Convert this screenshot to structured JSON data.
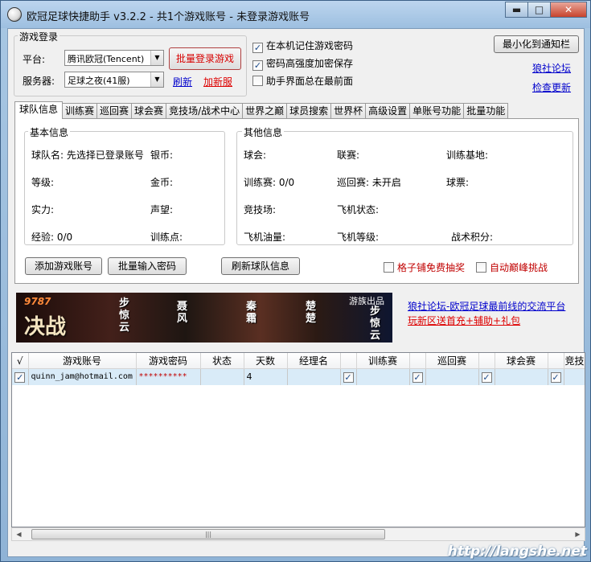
{
  "window": {
    "title": "欧冠足球快捷助手 v3.2.2  - 共1个游戏账号 - 未登录游戏账号",
    "minimize": "▬",
    "maximize": "□",
    "close": "✕"
  },
  "login": {
    "group_title": "游戏登录",
    "platform_label": "平台:",
    "platform_value": "腾讯欧冠(Tencent)",
    "server_label": "服务器:",
    "server_value": "足球之夜(41服)",
    "batch_login": "批量登录游戏",
    "refresh": "刷新",
    "add_server": "加新服"
  },
  "options": [
    {
      "label": "在本机记住游戏密码",
      "checked": true
    },
    {
      "label": "密码高强度加密保存",
      "checked": true
    },
    {
      "label": "助手界面总在最前面",
      "checked": false
    }
  ],
  "right_actions": {
    "minimize_tray": "最小化到通知栏",
    "forum": "狼社论坛",
    "check_update": "检查更新"
  },
  "tabs": [
    "球队信息",
    "训练赛",
    "巡回赛",
    "球会赛",
    "竞技场/战术中心",
    "世界之巅",
    "球员搜索",
    "世界杯",
    "高级设置",
    "单账号功能",
    "批量功能"
  ],
  "basic_info": {
    "title": "基本信息",
    "team_name_label": "球队名:",
    "team_name_value": "先选择已登录账号",
    "silver_label": "银币:",
    "level_label": "等级:",
    "gold_label": "金币:",
    "strength_label": "实力:",
    "prestige_label": "声望:",
    "exp_label": "经验:",
    "exp_value": "0/0",
    "training_points_label": "训练点:"
  },
  "other_info": {
    "title": "其他信息",
    "club_label": "球会:",
    "league_label": "联赛:",
    "training_base_label": "训练基地:",
    "training_match_label": "训练赛:",
    "training_match_value": "0/0",
    "tour_label": "巡回赛:",
    "tour_value": "未开启",
    "ticket_label": "球票:",
    "arena_label": "竞技场:",
    "plane_status_label": "飞机状态:",
    "plane_fuel_label": "飞机油量:",
    "plane_level_label": "飞机等级:",
    "tactic_points_label": "战术积分:"
  },
  "panel_buttons": {
    "add_account": "添加游戏账号",
    "batch_password": "批量输入密码",
    "refresh_team": "刷新球队信息"
  },
  "panel_checks": {
    "free_draw": "格子铺免费抽奖",
    "auto_challenge": "自动巅峰挑战"
  },
  "banner": {
    "game_logo": "9787",
    "game_title": "决战",
    "characters": [
      "步惊云",
      "聂风",
      "秦霜",
      "楚楚"
    ],
    "badge": "游族出品",
    "hero": "步惊云"
  },
  "promo": {
    "forum_link": "狼社论坛-欧冠足球最前线的交流平台",
    "server_link": "玩新区送首充+辅助+礼包"
  },
  "table": {
    "headers": [
      "√",
      "游戏账号",
      "游戏密码",
      "状态",
      "天数",
      "经理名",
      "",
      "训练赛",
      "",
      "巡回赛",
      "",
      "球会赛",
      "",
      "竞技"
    ],
    "row": {
      "checked": true,
      "account": "quinn_jam@hotmail.com",
      "password": "**********",
      "status": "",
      "days": "4",
      "manager": ""
    }
  },
  "watermark": "http://langshe.net"
}
